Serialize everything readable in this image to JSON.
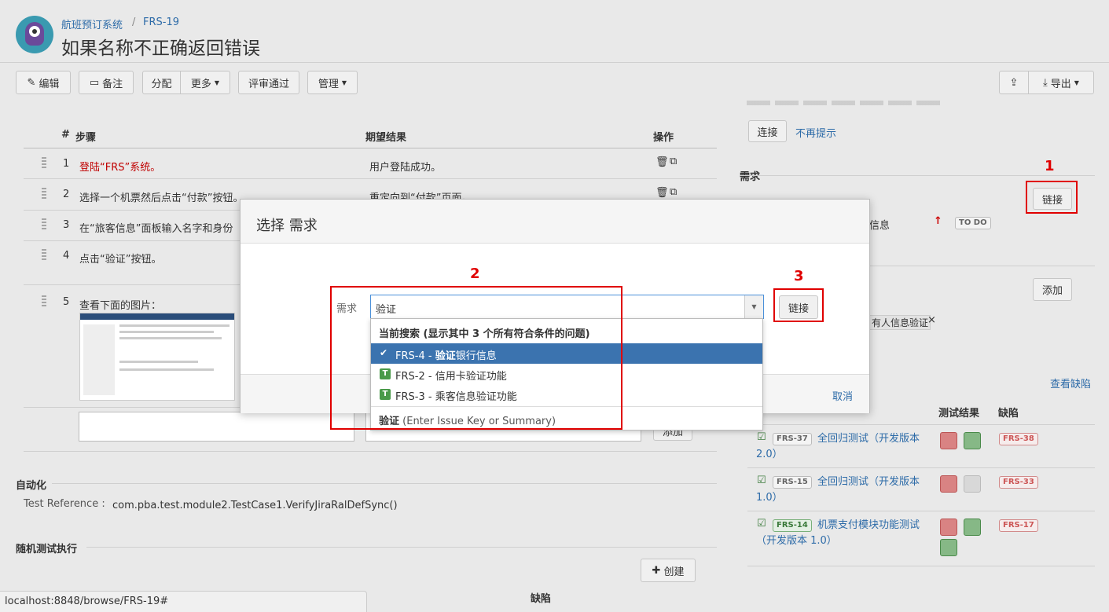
{
  "header": {
    "project": "航班预订系统",
    "separator": "/",
    "issue_key": "FRS-19",
    "title": "如果名称不正确返回错误"
  },
  "toolbar": {
    "edit": "编辑",
    "comment": "备注",
    "assign": "分配",
    "more": "更多",
    "review": "评审通过",
    "manage": "管理",
    "export": "导出"
  },
  "steps_table": {
    "headers": {
      "num": "#",
      "step": "步骤",
      "expected": "期望结果",
      "actions": "操作"
    },
    "rows": [
      {
        "num": "1",
        "step": "登陆“FRS”系统。",
        "expected": "用户登陆成功。"
      },
      {
        "num": "2",
        "step": "选择一个机票然后点击“付款”按钮。",
        "expected": "重定向到“付款”页面。"
      },
      {
        "num": "3",
        "step": "在“旅客信息”面板输入名字和身份",
        "expected": ""
      },
      {
        "num": "4",
        "step": "点击“验证”按钮。",
        "expected": ""
      },
      {
        "num": "5",
        "step": "查看下面的图片：",
        "expected": ""
      }
    ],
    "add_button": "添加"
  },
  "automation": {
    "heading": "自动化",
    "label": "Test Reference :",
    "value": "com.pba.test.module2.TestCase1.VerifyJiraRalDefSync()"
  },
  "adhoc": {
    "heading": "随机测试执行",
    "create_button": "创建",
    "defects_col": "缺陷"
  },
  "status_bar": {
    "url": "localhost:8848/browse/FRS-19#"
  },
  "right_panel": {
    "hint_link_button": "连接",
    "hint_dismiss": "不再提示",
    "requirements_heading": "需求",
    "req_link_button": "链接",
    "req_item_suffix": "信息",
    "req_status": "TO DO",
    "add_button": "添加",
    "tag_text": "有人信息验证",
    "tag_remove": "×",
    "view_defects": "查看缺陷",
    "exec_headers": {
      "result": "测试结果",
      "defects": "缺陷"
    },
    "executions": [
      {
        "key": "FRS-37",
        "name": "全回归测试（开发版本 2.0）",
        "defect": "FRS-38",
        "results": [
          "red",
          "green"
        ]
      },
      {
        "key": "FRS-15",
        "name": "全回归测试（开发版本 1.0）",
        "defect": "FRS-33",
        "results": [
          "red",
          "none"
        ]
      },
      {
        "key": "FRS-14",
        "name": "机票支付模块功能测试（开发版本 1.0）",
        "defect": "FRS-17",
        "results": [
          "red",
          "green",
          "green"
        ]
      }
    ]
  },
  "dialog": {
    "title": "选择 需求",
    "field_label": "需求",
    "search_value": "验证",
    "link_button": "链接",
    "cancel": "取消",
    "dropdown": {
      "section_header": "当前搜索 (显示其中 3 个所有符合条件的问题)",
      "items": [
        {
          "key": "FRS-4",
          "sep": " - ",
          "match": "验证",
          "rest": "银行信息",
          "selected": true
        },
        {
          "key": "FRS-2",
          "sep": " - ",
          "match": "",
          "rest": "信用卡验证功能",
          "selected": false
        },
        {
          "key": "FRS-3",
          "sep": " - ",
          "match": "",
          "rest": "乘客信息验证功能",
          "selected": false
        }
      ],
      "footer_bold": "验证",
      "footer_hint": "(Enter Issue Key or Summary)"
    }
  },
  "annotations": [
    "1",
    "2",
    "3"
  ],
  "colors": {
    "link": "#2d6ba8",
    "annotation": "#e00000",
    "selected_row": "#3b73af",
    "step_red": "#c00000"
  }
}
